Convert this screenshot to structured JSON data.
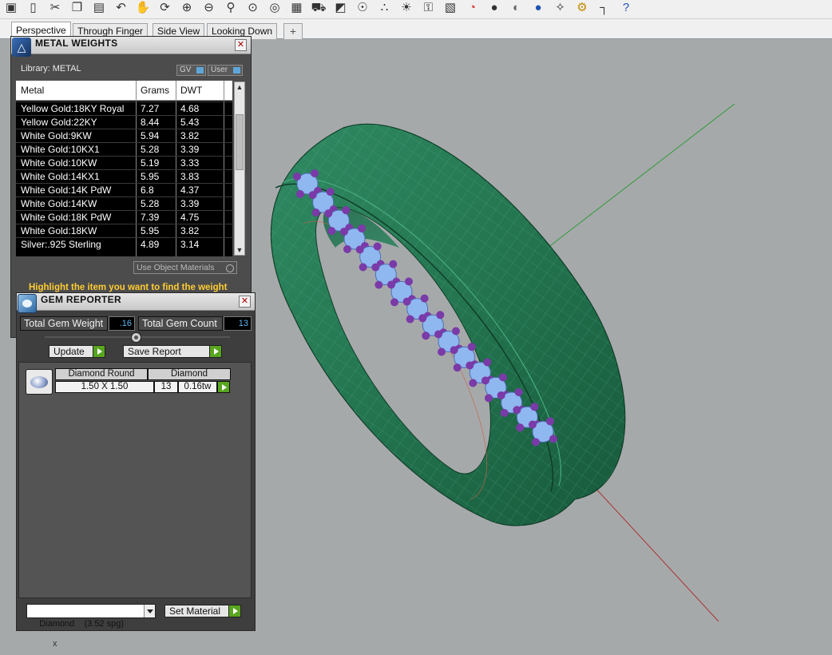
{
  "toolbar": {
    "icons": [
      "save-icon",
      "new-doc-icon",
      "cut-icon",
      "copy-icon",
      "paste-icon",
      "undo-icon",
      "pan-icon",
      "rotate-icon",
      "zoom-window-icon",
      "zoom-dynamic-icon",
      "zoom-extents-icon",
      "zoom-selected-icon",
      "zoom-target-icon",
      "grid-icon",
      "car-icon",
      "shade-icon",
      "snap-icon",
      "points-icon",
      "light-icon",
      "lock-icon",
      "layers-icon",
      "color-wheel-icon",
      "sphere-gray-icon",
      "sphere-metal-icon",
      "sphere-blue-icon",
      "wand-icon",
      "gear-icon",
      "dimension-icon",
      "help-icon"
    ]
  },
  "viewport_tabs": {
    "tabs": [
      "Perspective",
      "Through Finger",
      "Side View",
      "Looking Down"
    ],
    "add_label": "+"
  },
  "colors": {
    "accent_green": "#58a51f",
    "value_blue": "#59b7f4",
    "warning_yellow": "#ffcc33",
    "ring_green": "#2a7f5a",
    "gem_blue": "#8fb7f0",
    "prong_purple": "#7a3aa8"
  },
  "metal_weights": {
    "title": "METAL WEIGHTS",
    "library_label": "Library: METAL",
    "toggle_gv": "GV",
    "toggle_user": "User",
    "columns": [
      "Metal",
      "Grams",
      "DWT"
    ],
    "rows": [
      [
        "Yellow Gold:18KY Royal",
        "7.27",
        "4.68"
      ],
      [
        "Yellow Gold:22KY",
        "8.44",
        "5.43"
      ],
      [
        "White Gold:9KW",
        "5.94",
        "3.82"
      ],
      [
        "White Gold:10KX1",
        "5.28",
        "3.39"
      ],
      [
        "White Gold:10KW",
        "5.19",
        "3.33"
      ],
      [
        "White Gold:14KX1",
        "5.95",
        "3.83"
      ],
      [
        "White Gold:14K PdW",
        "6.8",
        "4.37"
      ],
      [
        "White Gold:14KW",
        "5.28",
        "3.39"
      ],
      [
        "White Gold:18K PdW",
        "7.39",
        "4.75"
      ],
      [
        "White Gold:18KW",
        "5.95",
        "3.82"
      ],
      [
        "Silver:.925 Sterling",
        "4.89",
        "3.14"
      ]
    ],
    "use_object_materials": "Use Object Materials",
    "highlight_msg": "Highlight the item you want to find the weight"
  },
  "gem_reporter": {
    "title": "GEM REPORTER",
    "total_weight_label": "Total Gem Weight",
    "total_weight_value": ".16",
    "total_count_label": "Total Gem Count",
    "total_count_value": "13",
    "update_label": "Update",
    "save_report_label": "Save Report",
    "gem_row": {
      "shape": "Diamond Round",
      "material": "Diamond",
      "size": "1.50 X 1.50",
      "count": "13",
      "weight": "0.16tw"
    },
    "material_select": "Diamond    (3.52 spg)",
    "set_material_label": "Set Material"
  },
  "viewport": {
    "corner_marker": "x"
  }
}
